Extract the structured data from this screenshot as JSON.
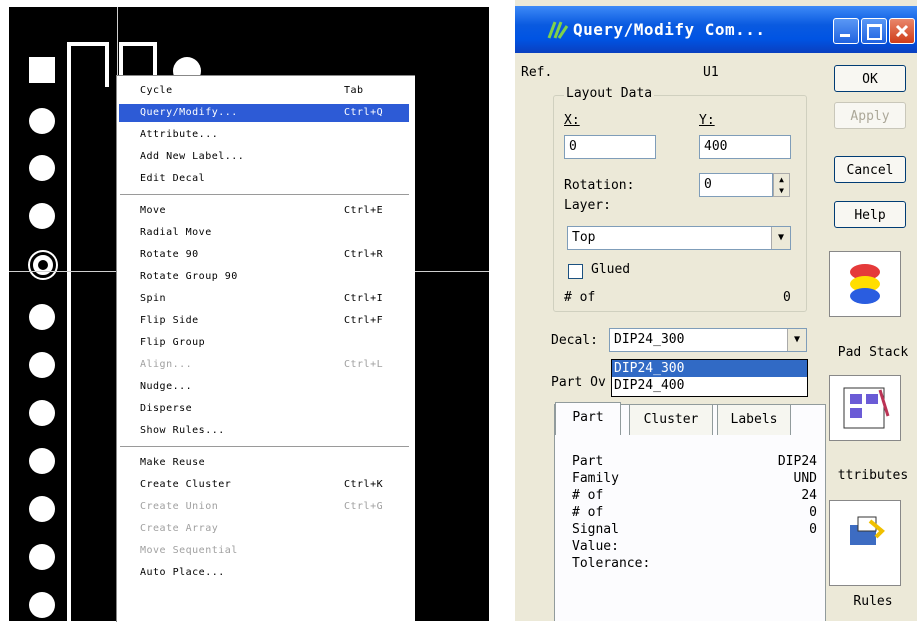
{
  "pcb": {
    "context_menu": {
      "groups": [
        [
          {
            "label": "Cycle",
            "shortcut": "Tab",
            "state": "normal"
          },
          {
            "label": "Query/Modify...",
            "shortcut": "Ctrl+Q",
            "state": "highlighted"
          },
          {
            "label": "Attribute...",
            "shortcut": "",
            "state": "normal"
          },
          {
            "label": "Add New Label...",
            "shortcut": "",
            "state": "normal"
          },
          {
            "label": "Edit Decal",
            "shortcut": "",
            "state": "normal"
          }
        ],
        [
          {
            "label": "Move",
            "shortcut": "Ctrl+E",
            "state": "normal"
          },
          {
            "label": "Radial Move",
            "shortcut": "",
            "state": "normal"
          },
          {
            "label": "Rotate 90",
            "shortcut": "Ctrl+R",
            "state": "normal"
          },
          {
            "label": "Rotate Group 90",
            "shortcut": "",
            "state": "normal"
          },
          {
            "label": "Spin",
            "shortcut": "Ctrl+I",
            "state": "normal"
          },
          {
            "label": "Flip Side",
            "shortcut": "Ctrl+F",
            "state": "normal"
          },
          {
            "label": "Flip Group",
            "shortcut": "",
            "state": "normal"
          },
          {
            "label": "Align...",
            "shortcut": "Ctrl+L",
            "state": "disabled"
          },
          {
            "label": "Nudge...",
            "shortcut": "",
            "state": "normal"
          },
          {
            "label": "Disperse",
            "shortcut": "",
            "state": "normal"
          },
          {
            "label": "Show Rules...",
            "shortcut": "",
            "state": "normal"
          }
        ],
        [
          {
            "label": "Make Reuse",
            "shortcut": "",
            "state": "normal"
          },
          {
            "label": "Create Cluster",
            "shortcut": "Ctrl+K",
            "state": "normal"
          },
          {
            "label": "Create Union",
            "shortcut": "Ctrl+G",
            "state": "disabled"
          },
          {
            "label": "Create Array",
            "shortcut": "",
            "state": "disabled"
          },
          {
            "label": "Move Sequential",
            "shortcut": "",
            "state": "disabled"
          },
          {
            "label": "Auto Place...",
            "shortcut": "",
            "state": "normal"
          }
        ]
      ]
    }
  },
  "dialog": {
    "title": "Query/Modify Com...",
    "ref_label": "Ref.",
    "ref_value": "U1",
    "layout_group_title": "Layout Data",
    "x_label": "X:",
    "y_label": "Y:",
    "x_value": "0",
    "y_value": "400",
    "rotation_label": "Rotation:",
    "rotation_value": "0",
    "layer_label": "Layer:",
    "layer_value": "Top",
    "glued_label": "Glued",
    "num_of_label": "# of",
    "num_of_value": "0",
    "decal_label": "Decal:",
    "decal_value": "DIP24_300",
    "decal_options": [
      "DIP24_300",
      "DIP24_400"
    ],
    "part_partial_label": "Part Ov",
    "buttons": {
      "ok": "OK",
      "apply": "Apply",
      "cancel": "Cancel",
      "help": "Help"
    },
    "side_buttons": {
      "pad_stack": "Pad Stack",
      "attributes": "ttributes",
      "rules": "Rules"
    },
    "tabs": [
      "Part",
      "Cluster",
      "Labels"
    ],
    "part_tab": {
      "rows": [
        {
          "label": "Part",
          "value": "DIP24"
        },
        {
          "label": "Family",
          "value": "UND"
        },
        {
          "label": "# of",
          "value": "24"
        },
        {
          "label": "# of",
          "value": "0"
        },
        {
          "label": "Signal",
          "value": "0"
        },
        {
          "label": "Value:",
          "value": ""
        },
        {
          "label": "Tolerance:",
          "value": ""
        }
      ]
    }
  }
}
